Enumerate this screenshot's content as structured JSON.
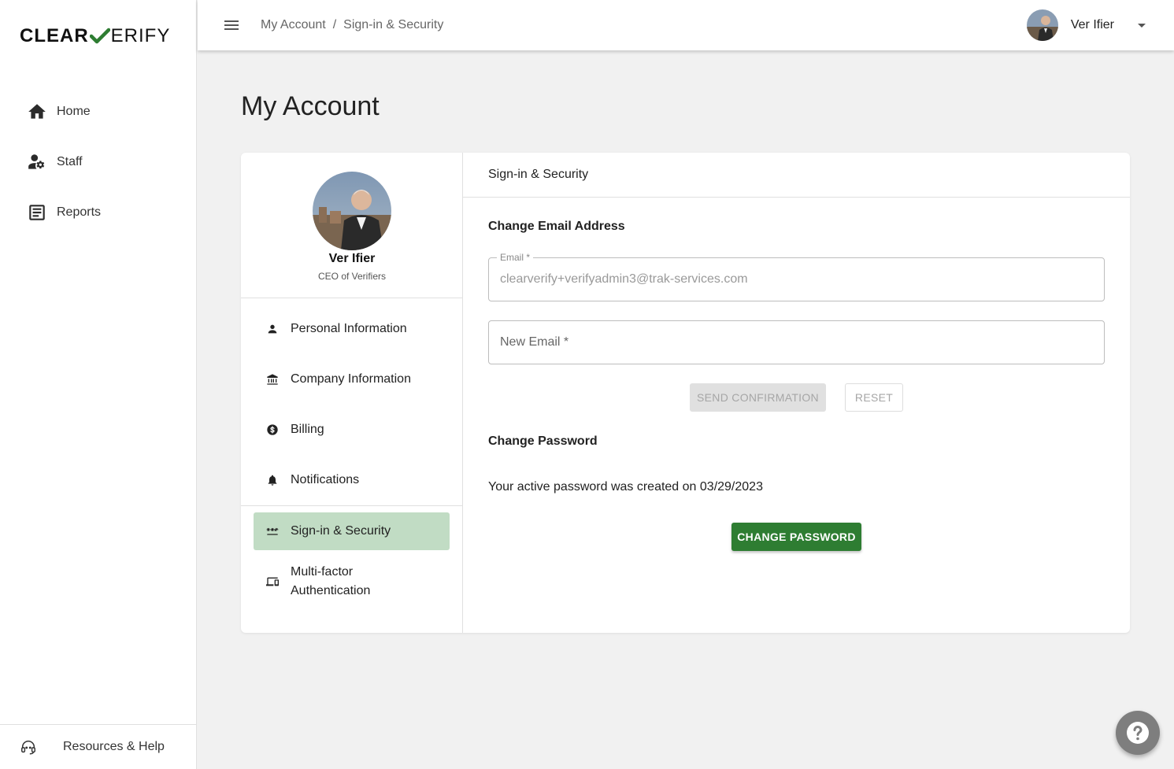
{
  "brand": {
    "left": "CLEAR",
    "right": "ERIFY"
  },
  "sidebar": {
    "items": [
      {
        "label": "Home",
        "icon": "home-icon"
      },
      {
        "label": "Staff",
        "icon": "staff-gear-icon"
      },
      {
        "label": "Reports",
        "icon": "reports-icon"
      }
    ],
    "footer": {
      "label": "Resources & Help",
      "icon": "headset-icon"
    }
  },
  "topbar": {
    "breadcrumb": [
      "My Account",
      "Sign-in & Security"
    ],
    "separator": "/",
    "user_name": "Ver Ifier"
  },
  "page": {
    "title": "My Account"
  },
  "profile": {
    "name": "Ver Ifier",
    "role": "CEO of Verifiers"
  },
  "account_menu": [
    {
      "label": "Personal Information",
      "icon": "person-icon"
    },
    {
      "label": "Company Information",
      "icon": "bank-icon"
    },
    {
      "label": "Billing",
      "icon": "dollar-icon"
    },
    {
      "label": "Notifications",
      "icon": "bell-icon"
    },
    {
      "label": "Sign-in & Security",
      "icon": "password-icon",
      "active": true
    },
    {
      "label": "Multi-factor Authentication",
      "icon": "devices-icon"
    }
  ],
  "panel": {
    "header": "Sign-in & Security",
    "email_section": {
      "title": "Change Email Address",
      "email_label": "Email *",
      "email_value": "clearverify+verifyadmin3@trak-services.com",
      "new_email_placeholder": "New Email *",
      "send_label": "SEND CONFIRMATION",
      "reset_label": "RESET"
    },
    "password_section": {
      "title": "Change Password",
      "info": "Your active password was created on 03/29/2023",
      "button_label": "CHANGE PASSWORD"
    }
  },
  "colors": {
    "accent": "#2e7d32",
    "active_bg": "#c1dcc4",
    "fab": "#7e7e7e"
  }
}
